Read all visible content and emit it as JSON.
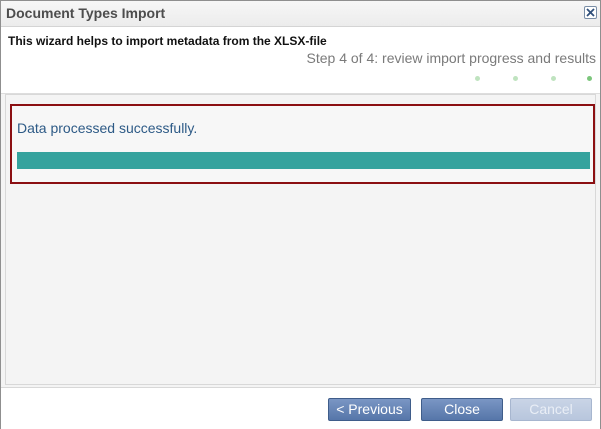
{
  "window": {
    "title": "Document Types Import",
    "close_icon": "close-icon"
  },
  "wizard": {
    "description": "This wizard helps to import metadata from the XLSX-file",
    "step_text": "Step 4 of 4: review import progress and results",
    "current_step": 4,
    "total_steps": 4
  },
  "result": {
    "status_text": "Data processed successfully.",
    "progress_fraction": 1.0
  },
  "buttons": {
    "previous_label": "< Previous",
    "close_label": "Close",
    "cancel_label": "Cancel",
    "cancel_enabled": false
  },
  "colors": {
    "progress_fill": "#35a39e",
    "highlight_border": "#8b0f12",
    "step_dot_active": "#7cc67c",
    "step_dot_inactive": "#bfe3bf"
  }
}
